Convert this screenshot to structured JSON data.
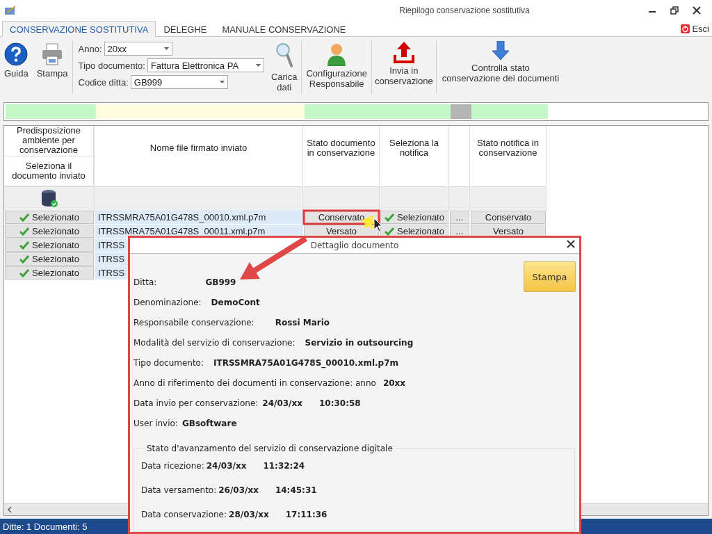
{
  "window": {
    "title": "Riepilogo conservazione sostitutiva"
  },
  "tabs": [
    {
      "label": "CONSERVAZIONE SOSTITUTIVA",
      "selected": true
    },
    {
      "label": "DELEGHE",
      "selected": false
    },
    {
      "label": "MANUALE CONSERVAZIONE",
      "selected": false
    }
  ],
  "exit_button": {
    "label": "Esci"
  },
  "toolbar": [
    {
      "kind": "help",
      "lines": [
        "Guida"
      ]
    },
    {
      "kind": "print",
      "lines": [
        "Stampa"
      ]
    },
    {
      "kind": "filters",
      "fields": [
        {
          "label": "Anno:",
          "value": "20xx"
        },
        {
          "label": "Tipo documento:",
          "value": "Fattura Elettronica PA"
        },
        {
          "label": "Codice ditta:",
          "value": "GB999"
        }
      ]
    },
    {
      "kind": "search",
      "lines": [
        "Carica",
        "dati"
      ]
    },
    {
      "kind": "user",
      "lines": [
        "Configurazione",
        "Responsabile"
      ]
    },
    {
      "kind": "upload",
      "lines": [
        "Invia in",
        "conservazione"
      ]
    },
    {
      "kind": "download",
      "lines": [
        "Controlla stato",
        "conservazione dei documenti"
      ]
    }
  ],
  "status_strip": [
    {
      "color": "#c6f7c6"
    },
    {
      "color": "#fffde0"
    },
    {
      "color": "#c6f7c6"
    },
    {
      "color": "#c6f7c6"
    },
    {
      "color": "#b4b4b4"
    },
    {
      "color": "#c6f7c6"
    }
  ],
  "table": {
    "columns": [
      {
        "title": "Predisposizione ambiente per conservazione",
        "subtitle": "Seleziona il documento inviato"
      },
      {
        "title": "Nome file firmato inviato"
      },
      {
        "title": "Stato documento in conservazione"
      },
      {
        "title": "Seleziona la notifica"
      },
      {},
      {
        "title": "Stato notifica in conservazione"
      }
    ],
    "rows": [
      {
        "selection": "Selezionato",
        "file": "ITRSSMRA75A01G478S_00010.xml.p7m",
        "status": "Conservato",
        "notice": "Selezionato",
        "more": "...",
        "notice_status": "Conservato",
        "highlighted": true
      },
      {
        "selection": "Selezionato",
        "file": "ITRSSMRA75A01G478S_00011.xml.p7m",
        "status": "Versato",
        "notice": "Selezionato",
        "more": "...",
        "notice_status": "Versato",
        "highlighted": false
      },
      {
        "selection": "Selezionato",
        "file": "ITRSS",
        "highlighted": false
      },
      {
        "selection": "Selezionato",
        "file": "ITRSS",
        "highlighted": false
      },
      {
        "selection": "Selezionato",
        "file": "ITRSS",
        "highlighted": false
      }
    ]
  },
  "status_bar": {
    "text": "Ditte: 1 Documenti: 5"
  },
  "dialog": {
    "title": "Dettaglio documento",
    "print_button": "Stampa",
    "fields": [
      {
        "label": "Ditta:",
        "value": "GB999"
      },
      {
        "label": "Denominazione:",
        "value": "DemoCont"
      },
      {
        "label": "Responsabile conservazione:",
        "value": "Rossi Mario"
      },
      {
        "label": "Modalità del servizio di conservazione:",
        "value": "Servizio in outsourcing"
      },
      {
        "label": "Tipo documento:",
        "value": "ITRSSMRA75A01G478S_00010.xml.p7m"
      },
      {
        "label": "Anno di riferimento dei documenti in conservazione: anno",
        "value": "20xx"
      },
      {
        "label": "Data invio per conservazione:",
        "value": "24/03/xx",
        "time": "10:30:58"
      },
      {
        "label": "User invio:",
        "value": "GBsoftware"
      }
    ],
    "group": {
      "title": "Stato d'avanzamento del servizio di conservazione digitale",
      "entries": [
        {
          "label": "Data ricezione:",
          "date": "24/03/xx",
          "time": "11:32:24"
        },
        {
          "label": "Data versamento:",
          "date": "26/03/xx",
          "time": "14:45:31"
        },
        {
          "label": "Data conservazione:",
          "date": "28/03/xx",
          "time": "17:11:36"
        }
      ]
    }
  }
}
